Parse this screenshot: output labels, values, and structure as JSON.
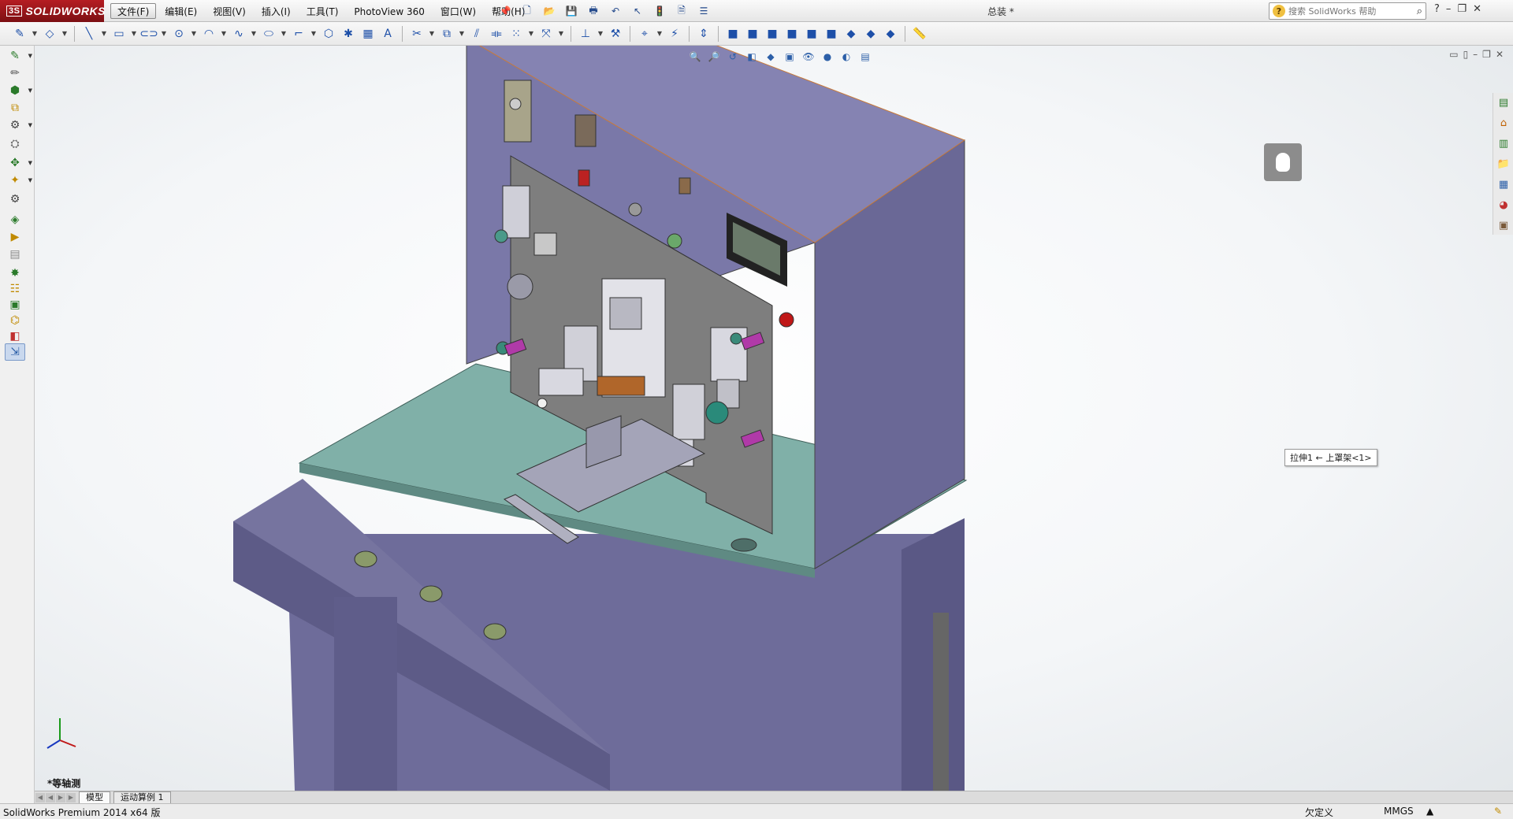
{
  "app": {
    "logo_ds": "3S",
    "logo_text": "SOLIDWORKS",
    "doc_title": "总装 *"
  },
  "menu": [
    "文件(F)",
    "编辑(E)",
    "视图(V)",
    "插入(I)",
    "工具(T)",
    "PhotoView 360",
    "窗口(W)",
    "帮助(H)"
  ],
  "search": {
    "placeholder": "搜索 SolidWorks 帮助"
  },
  "view": {
    "name": "*等轴测",
    "tooltip": "拉伸1 ← 上罩架<1>"
  },
  "tabs": [
    "模型",
    "运动算例 1"
  ],
  "status": {
    "left": "SolidWorks Premium 2014 x64 版",
    "state": "欠定义",
    "units": "MMGS"
  },
  "colors": {
    "logo_red": "#b51d22",
    "frame_purple": "#7a78a8",
    "plate_gray": "#7e7e7e",
    "table_green": "#80b0a8"
  }
}
